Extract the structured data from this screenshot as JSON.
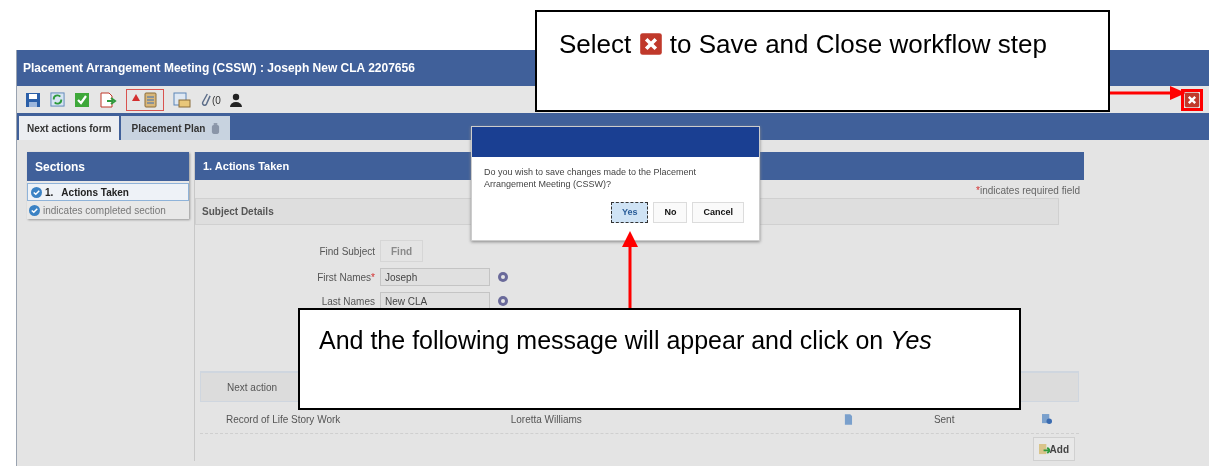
{
  "window": {
    "title": "Placement Arrangement Meeting (CSSW) :  Joseph New CLA  2207656"
  },
  "toolbar": {
    "attachment_count": "(0"
  },
  "tabs": [
    {
      "label": "Next actions form",
      "selected": true
    },
    {
      "label": "Placement Plan",
      "selected": false
    }
  ],
  "sections": {
    "title": "Sections",
    "items": [
      {
        "number": "1.",
        "label": "Actions Taken",
        "completed": true,
        "selected": true
      }
    ],
    "legend": "indicates completed section"
  },
  "form": {
    "title": "1. Actions Taken",
    "required_mark": "*",
    "required_note": "indicates required field",
    "subject_heading": "Subject Details",
    "find_label": "Find Subject",
    "find_button": "Find",
    "fields": [
      {
        "label": "First Names",
        "required_mark": "*",
        "value": "Joseph"
      },
      {
        "label": "Last Names",
        "value": "New CLA"
      }
    ],
    "table": {
      "columns": [
        "Next action"
      ],
      "rows": [
        {
          "action": "Record of Life Story Work",
          "person": "Loretta Williams",
          "status": "Sent"
        }
      ]
    },
    "add_button": "Add"
  },
  "dialog": {
    "message": "Do you wish to save changes made to the Placement Arrangement Meeting (CSSW)?",
    "buttons": [
      {
        "label": "Yes",
        "selected": true
      },
      {
        "label": "No",
        "selected": false
      },
      {
        "label": "Cancel",
        "selected": false
      }
    ]
  },
  "callout_save": {
    "before": "Select",
    "after": "to Save and Close workflow step"
  },
  "callout_message": {
    "text": "And the following message will appear and click on *Yes*"
  }
}
